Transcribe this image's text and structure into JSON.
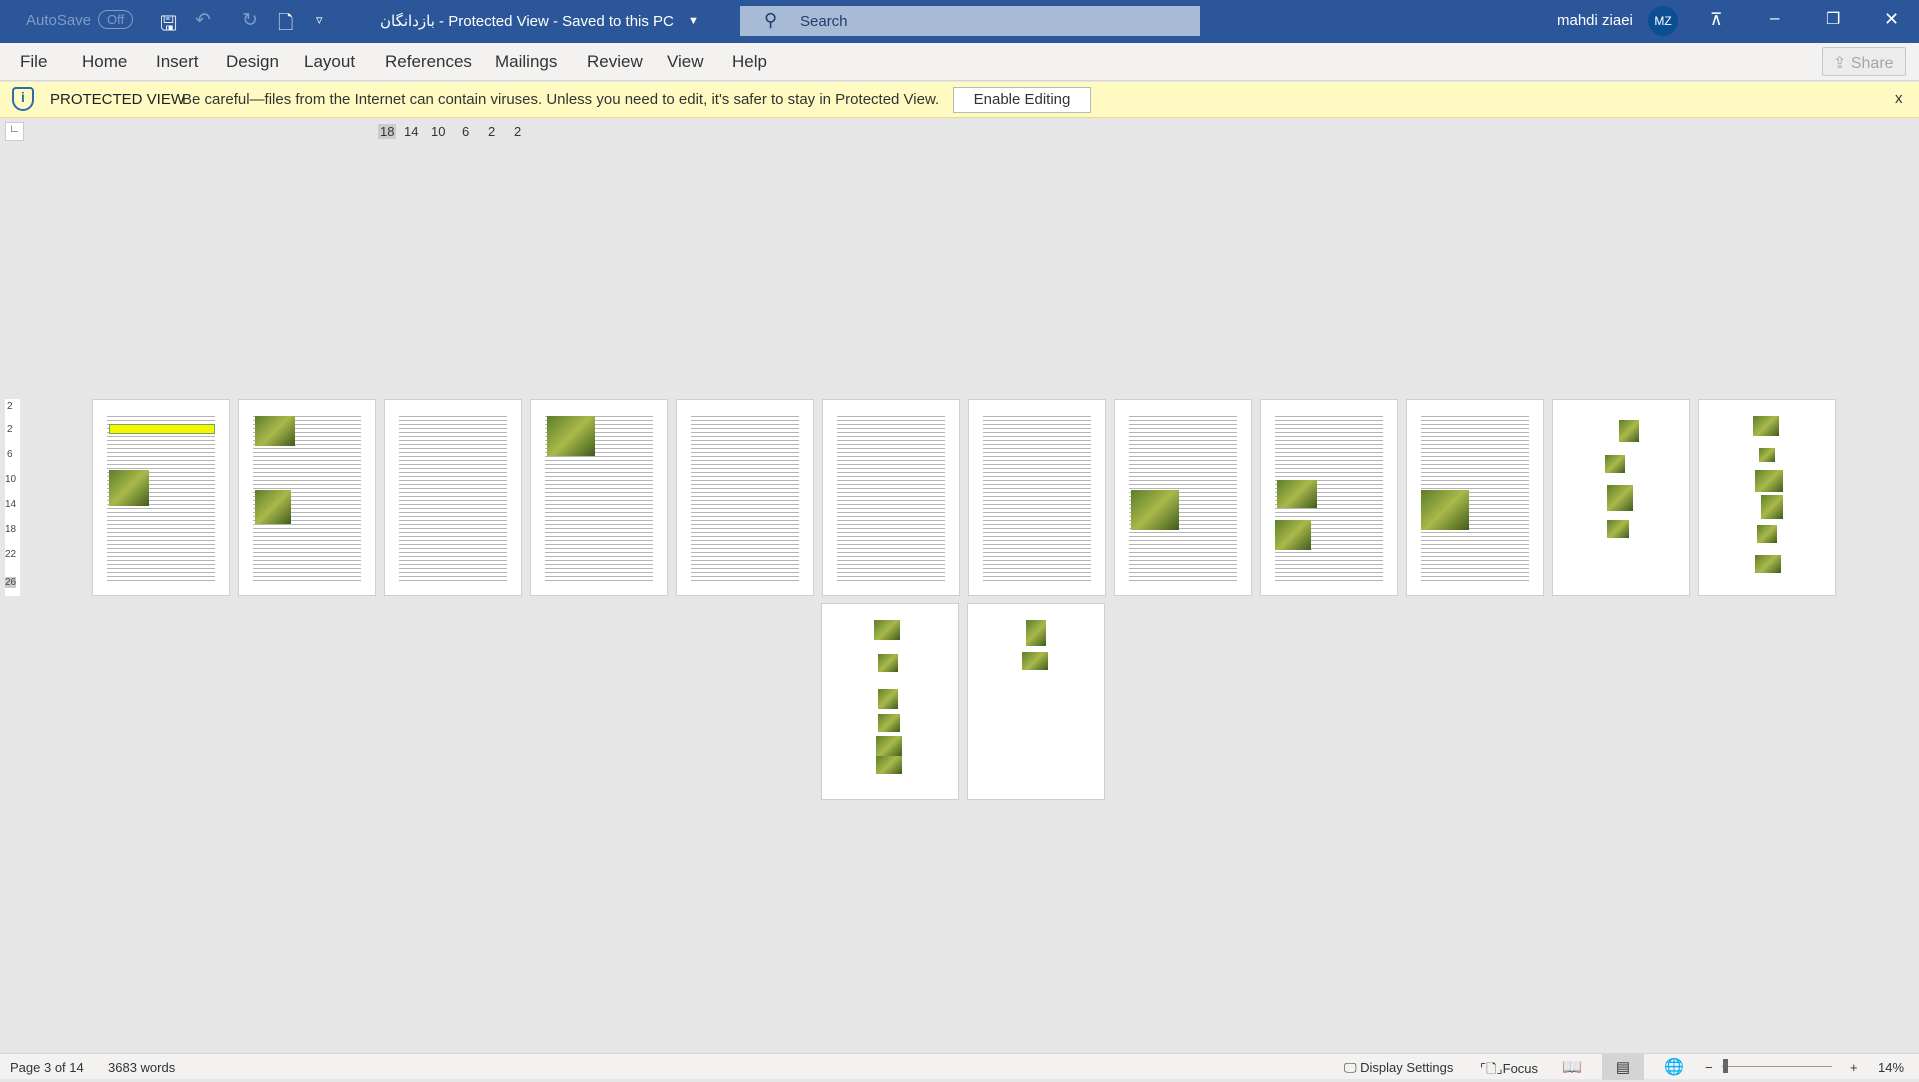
{
  "titlebar": {
    "autosave_label": "AutoSave",
    "autosave_state": "Off",
    "doc_title": "بازدانگان  -  Protected View  -  Saved to this PC",
    "search_placeholder": "Search",
    "user_name": "mahdi ziaei",
    "user_initials": "MZ"
  },
  "menu": {
    "items": [
      "File",
      "Home",
      "Insert",
      "Design",
      "Layout",
      "References",
      "Mailings",
      "Review",
      "View",
      "Help"
    ],
    "share": "Share"
  },
  "protected_view": {
    "title": "PROTECTED VIEW",
    "message": "Be careful—files from the Internet can contain viruses. Unless you need to edit, it's safer to stay in Protected View.",
    "enable_button": "Enable Editing",
    "close": "x"
  },
  "ruler": {
    "ticks": [
      "18",
      "14",
      "10",
      "6",
      "2",
      "2"
    ],
    "vticks": [
      "2",
      "2",
      "6",
      "10",
      "14",
      "18",
      "22",
      "26"
    ]
  },
  "status": {
    "page": "Page 3 of 14",
    "words": "3683 words",
    "display_settings": "Display Settings",
    "focus": "Focus",
    "zoom": "14%",
    "zoom_percent": 14
  },
  "colors": {
    "titlebar": "#2b579a",
    "protected_bar": "#fff9c2"
  }
}
